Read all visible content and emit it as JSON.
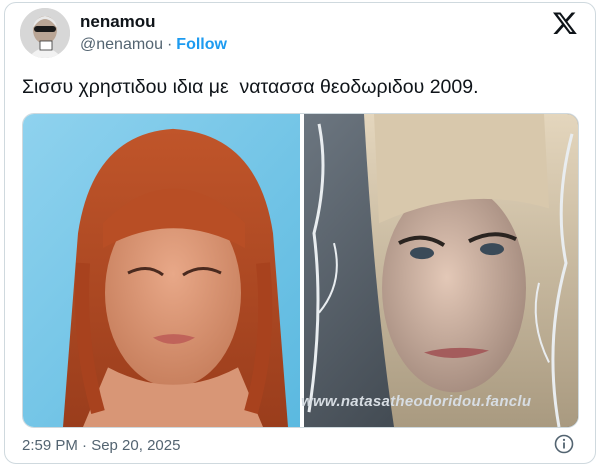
{
  "author": {
    "name": "nenamou",
    "handle": "@nenamou",
    "separator": "·",
    "follow_label": "Follow",
    "avatar_icon": "profile-avatar-icon"
  },
  "platform_icon": "x-logo-icon",
  "tweet": {
    "text": "Σισσυ χρηστιδου ιδια με  νατασσα θεοδωριδου 2009."
  },
  "media": {
    "left_photo": "red-haired-woman-photo",
    "right_photo": "blonde-woman-photo",
    "watermark": "www.natasatheodoridou.fanclu"
  },
  "footer": {
    "timestamp": "2:59 PM · Sep 20, 2025",
    "info_icon": "info-icon"
  },
  "colors": {
    "accent": "#1d9bf0",
    "text_primary": "#0f1419",
    "text_secondary": "#536471",
    "border": "#cfd9de"
  }
}
